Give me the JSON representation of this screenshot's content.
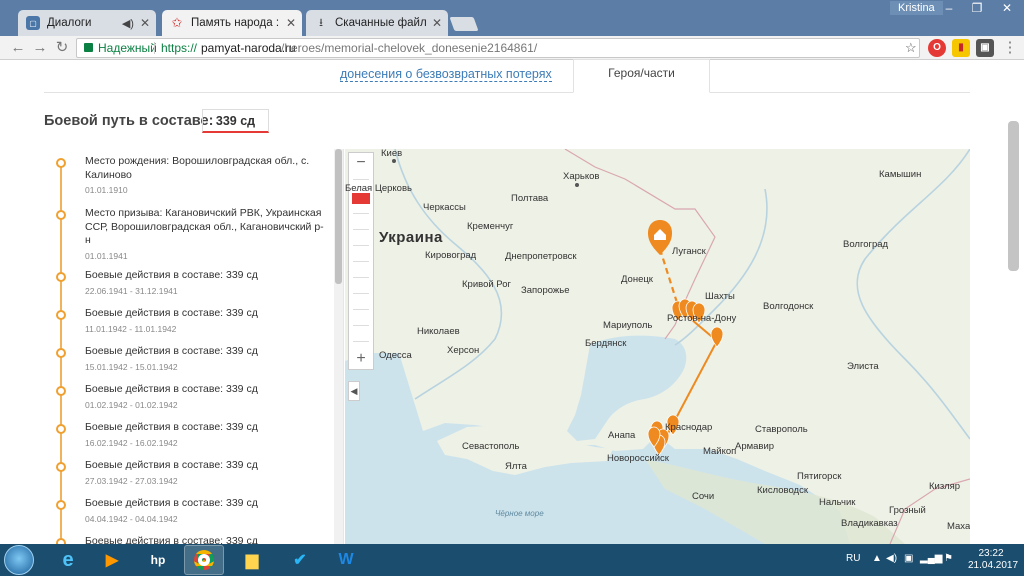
{
  "browser": {
    "tabs": [
      {
        "title": "Диалоги",
        "icon": "vk-icon"
      },
      {
        "title": "Память народа :: Донес",
        "icon": "star-icon"
      },
      {
        "title": "Скачанные файлы",
        "icon": "download-icon"
      }
    ],
    "user": "Kristina",
    "address": {
      "secure_label": "Надежный",
      "scheme": "https://",
      "host": "pamyat-naroda.ru",
      "path": "/heroes/memorial-chelovek_donesenie2164861/"
    }
  },
  "page": {
    "tab_link": "донесения о безвозвратных потерях",
    "tab_active": "Героя/части",
    "route_label": "Боевой путь в составе:",
    "unit": "339 сд",
    "timeline": [
      {
        "title": "Место рождения: Ворошиловградская обл., с. Калиново",
        "date": "01.01.1910"
      },
      {
        "title": "Место призыва: Кагановичский РВК, Украинская ССР, Ворошиловградская обл., Кагановичский р-н",
        "date": "01.01.1941"
      },
      {
        "title": "Боевые действия в составе: 339 сд",
        "date": "22.06.1941 - 31.12.1941"
      },
      {
        "title": "Боевые действия в составе: 339 сд",
        "date": "11.01.1942 - 11.01.1942"
      },
      {
        "title": "Боевые действия в составе: 339 сд",
        "date": "15.01.1942 - 15.01.1942"
      },
      {
        "title": "Боевые действия в составе: 339 сд",
        "date": "01.02.1942 - 01.02.1942"
      },
      {
        "title": "Боевые действия в составе: 339 сд",
        "date": "16.02.1942 - 16.02.1942"
      },
      {
        "title": "Боевые действия в составе: 339 сд",
        "date": "27.03.1942 - 27.03.1942"
      },
      {
        "title": "Боевые действия в составе: 339 сд",
        "date": "04.04.1942 - 04.04.1942"
      },
      {
        "title": "Боевые действия в составе: 339 сд",
        "date": ""
      }
    ]
  },
  "map": {
    "country": "Украина",
    "sea": "Чёрное море",
    "cities": {
      "kiev": "Киев",
      "belaya_tserkov": "Белая Церковь",
      "kharkov": "Харьков",
      "kamyshin": "Камышин",
      "cherkassy": "Черкассы",
      "poltava": "Полтава",
      "kremenchug": "Кременчуг",
      "lugansk": "Луганск",
      "volgograd": "Волгоград",
      "kirovograd": "Кировоград",
      "dnepropetrovsk": "Днепропетровск",
      "donetsk": "Донецк",
      "krivoy_rog": "Кривой Рог",
      "zaporozhye": "Запорожье",
      "shakhty": "Шахты",
      "volgodonsk": "Волгодонск",
      "rostov": "Ростов-на-Дону",
      "nikolaev": "Николаев",
      "mariupol": "Мариуполь",
      "berdyansk": "Бердянск",
      "odessa": "Одесса",
      "kherson": "Херсон",
      "elista": "Элиста",
      "sevastopol": "Севастополь",
      "anapa": "Анапа",
      "krasnodar": "Краснодар",
      "stavropol": "Ставрополь",
      "yalta": "Ялта",
      "armavir": "Армавир",
      "novorossiysk": "Новороссийск",
      "maykop": "Майкоп",
      "pyatigorsk": "Пятигорск",
      "kislovodsk": "Кисловодск",
      "sochi": "Сочи",
      "kizlyar": "Кизляр",
      "nalchik": "Нальчик",
      "grozny": "Грозный",
      "vladikavkaz": "Владикавказ",
      "makhachkala": "Махачкала"
    },
    "route_color": "#ee8a1f"
  },
  "taskbar": {
    "lang": "RU",
    "time": "23:22",
    "date": "21.04.2017"
  }
}
